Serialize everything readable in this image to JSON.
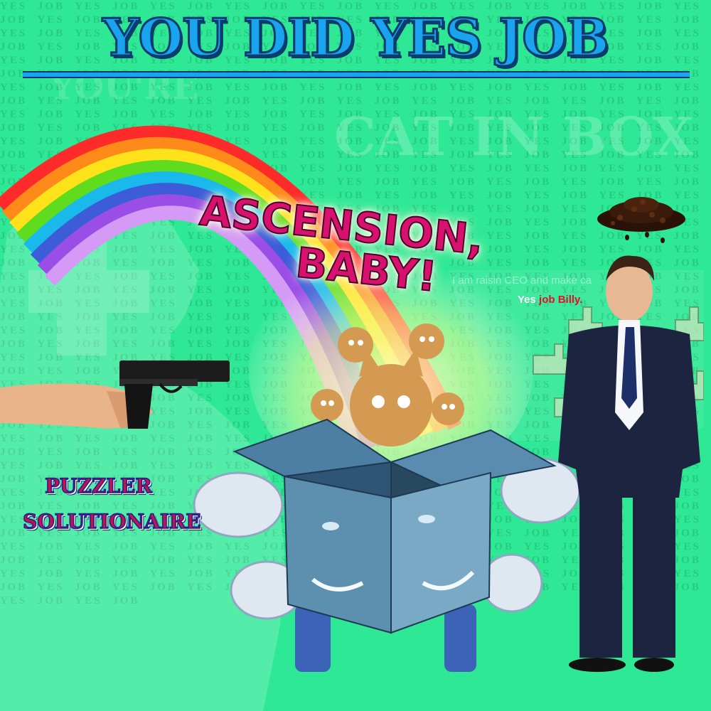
{
  "title": "YOU DID YES JOB",
  "background": {
    "color": "#2fe896",
    "wallpaper_text": "YES JOB",
    "ghost_text_top": "CAT IN BOX"
  },
  "headline": {
    "line1": "ASCENSION,",
    "line2": "BABY!"
  },
  "caption": {
    "faint": "I am raisin CEO and make ca",
    "word1": "Yes",
    "word2": "job",
    "word3": "Billy."
  },
  "badge": {
    "line1": "PUZZLER",
    "line2": "SOLUTIONAIRE"
  },
  "colors": {
    "title_fill": "#1aa3ee",
    "headline_fill": "#d8106e",
    "box": "#3c6e93",
    "suit": "#1c2440"
  },
  "icons": [
    "pistol-icon",
    "raisin-pile-icon",
    "thumbs-up-icon",
    "cat-head-icon",
    "cardboard-box-icon"
  ]
}
